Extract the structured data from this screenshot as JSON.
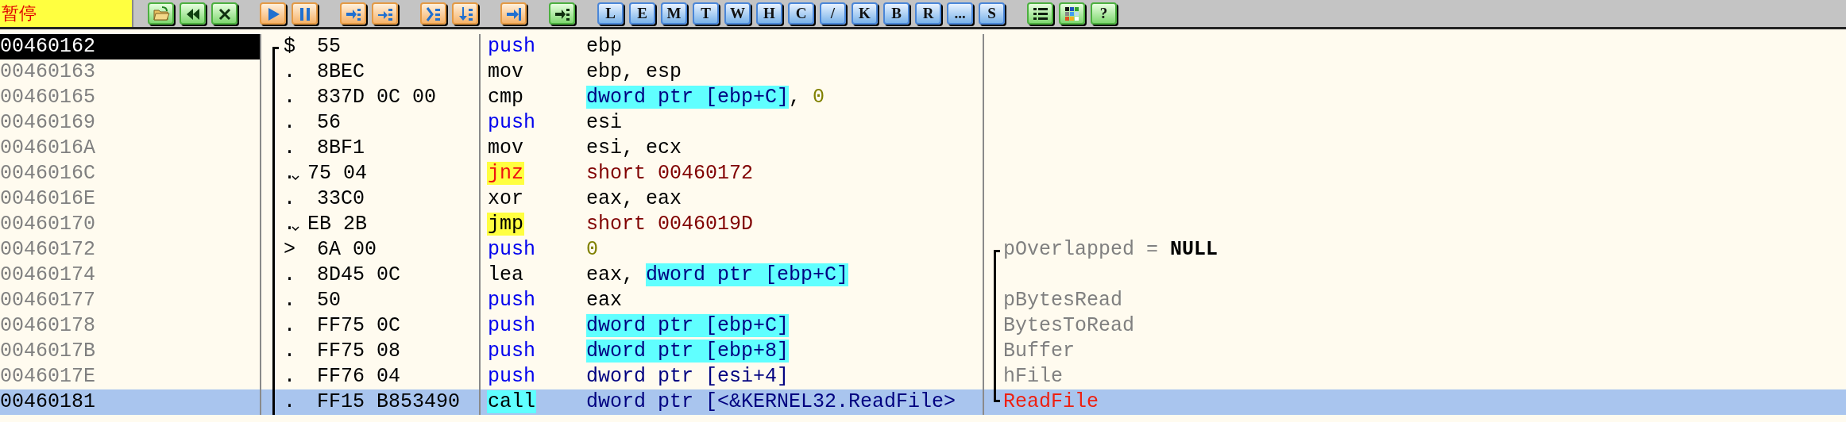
{
  "status": {
    "text": "暂停"
  },
  "toolbar": [
    [
      {
        "kind": "open"
      },
      {
        "kind": "rewind"
      },
      {
        "kind": "close"
      }
    ],
    [
      {
        "kind": "run"
      },
      {
        "kind": "pause"
      }
    ],
    [
      {
        "kind": "step_into"
      },
      {
        "kind": "step_over"
      }
    ],
    [
      {
        "kind": "trace_into"
      },
      {
        "kind": "trace_over"
      }
    ],
    [
      {
        "kind": "till_return"
      }
    ],
    [
      {
        "kind": "goto"
      }
    ],
    [
      {
        "kind": "letter",
        "label": "L"
      },
      {
        "kind": "letter",
        "label": "E"
      },
      {
        "kind": "letter",
        "label": "M"
      },
      {
        "kind": "letter",
        "label": "T"
      },
      {
        "kind": "letter",
        "label": "W"
      },
      {
        "kind": "letter",
        "label": "H"
      },
      {
        "kind": "letter",
        "label": "C"
      },
      {
        "kind": "letter",
        "label": "/"
      },
      {
        "kind": "letter",
        "label": "K"
      },
      {
        "kind": "letter",
        "label": "B"
      },
      {
        "kind": "letter",
        "label": "R"
      },
      {
        "kind": "letter",
        "label": "..."
      },
      {
        "kind": "letter",
        "label": "S"
      }
    ],
    [
      {
        "kind": "list"
      },
      {
        "kind": "palette"
      },
      {
        "kind": "help",
        "label": "?"
      }
    ]
  ],
  "rows": [
    {
      "address": "00460162",
      "current": true,
      "selected": false,
      "branch": {
        "kind": "start"
      },
      "marker": "$",
      "jump": false,
      "hex": "55",
      "mnemonic": "push",
      "kind": "push",
      "operands": [
        {
          "text": "ebp",
          "kind": "reg"
        }
      ]
    },
    {
      "address": "00460163",
      "current": false,
      "selected": false,
      "branch": {
        "kind": "mid"
      },
      "marker": ".",
      "jump": false,
      "hex": "8BEC",
      "mnemonic": "mov",
      "kind": "plain",
      "operands": [
        {
          "text": "ebp, esp",
          "kind": "reg"
        }
      ]
    },
    {
      "address": "00460165",
      "current": false,
      "selected": false,
      "branch": {
        "kind": "mid"
      },
      "marker": ".",
      "jump": false,
      "hex": "837D 0C 00",
      "mnemonic": "cmp",
      "kind": "plain",
      "operands": [
        {
          "text": "dword ptr [ebp+C]",
          "kind": "mem"
        },
        {
          "text": ", ",
          "kind": "reg"
        },
        {
          "text": "0",
          "kind": "const"
        }
      ]
    },
    {
      "address": "00460169",
      "current": false,
      "selected": false,
      "branch": {
        "kind": "mid"
      },
      "marker": ".",
      "jump": false,
      "hex": "56",
      "mnemonic": "push",
      "kind": "push",
      "operands": [
        {
          "text": "esi",
          "kind": "reg"
        }
      ]
    },
    {
      "address": "0046016A",
      "current": false,
      "selected": false,
      "branch": {
        "kind": "mid"
      },
      "marker": ".",
      "jump": false,
      "hex": "8BF1",
      "mnemonic": "mov",
      "kind": "plain",
      "operands": [
        {
          "text": "esi, ecx",
          "kind": "reg"
        }
      ]
    },
    {
      "address": "0046016C",
      "current": false,
      "selected": false,
      "branch": {
        "kind": "mid"
      },
      "marker": ".",
      "jump": true,
      "hex": "75 04",
      "mnemonic": "jnz",
      "kind": "jcc",
      "operands": [
        {
          "text": "short 00460172",
          "kind": "target"
        }
      ]
    },
    {
      "address": "0046016E",
      "current": false,
      "selected": false,
      "branch": {
        "kind": "mid"
      },
      "marker": ".",
      "jump": false,
      "hex": "33C0",
      "mnemonic": "xor",
      "kind": "plain",
      "operands": [
        {
          "text": "eax, eax",
          "kind": "reg"
        }
      ]
    },
    {
      "address": "00460170",
      "current": false,
      "selected": false,
      "branch": {
        "kind": "mid"
      },
      "marker": ".",
      "jump": true,
      "hex": "EB 2B",
      "mnemonic": "jmp",
      "kind": "jmp",
      "operands": [
        {
          "text": "short 0046019D",
          "kind": "target"
        }
      ]
    },
    {
      "address": "00460172",
      "current": false,
      "selected": false,
      "branch": {
        "kind": "mid"
      },
      "marker": ">",
      "jump": false,
      "hex": "6A 00",
      "mnemonic": "push",
      "kind": "push",
      "operands": [
        {
          "text": "0",
          "kind": "const"
        }
      ],
      "args": {
        "kind": "start"
      },
      "comment": [
        {
          "text": "pOverlapped = ",
          "kind": "arg"
        },
        {
          "text": "NULL",
          "kind": "value"
        }
      ]
    },
    {
      "address": "00460174",
      "current": false,
      "selected": false,
      "branch": {
        "kind": "mid"
      },
      "marker": ".",
      "jump": false,
      "hex": "8D45 0C",
      "mnemonic": "lea",
      "kind": "plain",
      "operands": [
        {
          "text": "eax, ",
          "kind": "reg"
        },
        {
          "text": "dword ptr [ebp+C]",
          "kind": "mem"
        }
      ],
      "args": {
        "kind": "mid"
      }
    },
    {
      "address": "00460177",
      "current": false,
      "selected": false,
      "branch": {
        "kind": "mid"
      },
      "marker": ".",
      "jump": false,
      "hex": "50",
      "mnemonic": "push",
      "kind": "push",
      "operands": [
        {
          "text": "eax",
          "kind": "reg"
        }
      ],
      "args": {
        "kind": "mid"
      },
      "comment": [
        {
          "text": "pBytesRead",
          "kind": "arg"
        }
      ]
    },
    {
      "address": "00460178",
      "current": false,
      "selected": false,
      "branch": {
        "kind": "mid"
      },
      "marker": ".",
      "jump": false,
      "hex": "FF75 0C",
      "mnemonic": "push",
      "kind": "push",
      "operands": [
        {
          "text": "dword ptr [ebp+C]",
          "kind": "mem"
        }
      ],
      "args": {
        "kind": "mid"
      },
      "comment": [
        {
          "text": "BytesToRead",
          "kind": "arg"
        }
      ]
    },
    {
      "address": "0046017B",
      "current": false,
      "selected": false,
      "branch": {
        "kind": "mid"
      },
      "marker": ".",
      "jump": false,
      "hex": "FF75 08",
      "mnemonic": "push",
      "kind": "push",
      "operands": [
        {
          "text": "dword ptr [ebp+8]",
          "kind": "mem"
        }
      ],
      "args": {
        "kind": "mid"
      },
      "comment": [
        {
          "text": "Buffer",
          "kind": "arg"
        }
      ]
    },
    {
      "address": "0046017E",
      "current": false,
      "selected": false,
      "branch": {
        "kind": "mid"
      },
      "marker": ".",
      "jump": false,
      "hex": "FF76 04",
      "mnemonic": "push",
      "kind": "push",
      "operands": [
        {
          "text": "dword ptr [esi+4]",
          "kind": "memplain"
        }
      ],
      "args": {
        "kind": "mid"
      },
      "comment": [
        {
          "text": "hFile",
          "kind": "arg"
        }
      ]
    },
    {
      "address": "00460181",
      "current": false,
      "selected": true,
      "branch": {
        "kind": "mid"
      },
      "marker": ".",
      "jump": false,
      "hex": "FF15 B853490",
      "mnemonic": "call",
      "kind": "call",
      "operands": [
        {
          "text": "dword ptr [<&KERNEL32.ReadFile>",
          "kind": "memplain"
        }
      ],
      "args": {
        "kind": "end"
      },
      "comment": [
        {
          "text": "ReadFile",
          "kind": "func"
        }
      ]
    }
  ]
}
